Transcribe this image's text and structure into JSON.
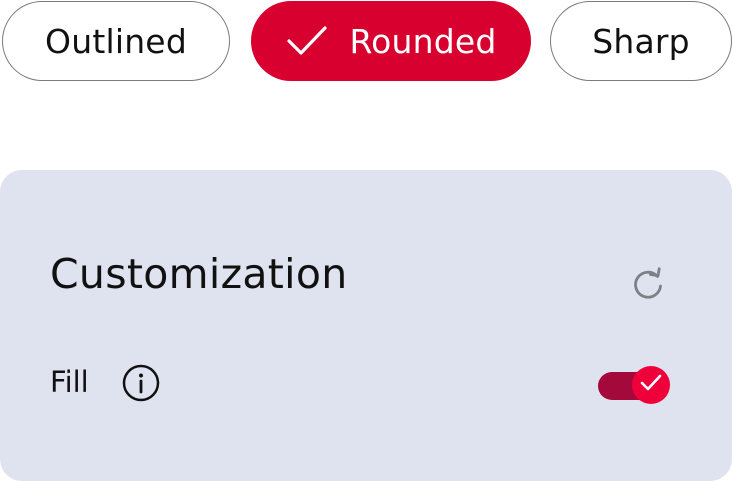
{
  "style_selector": {
    "options": [
      {
        "label": "Outlined",
        "selected": false
      },
      {
        "label": "Rounded",
        "selected": true
      },
      {
        "label": "Sharp",
        "selected": false
      }
    ],
    "selected_icon": "check-icon"
  },
  "customization": {
    "title": "Customization",
    "reset_icon": "refresh-icon",
    "fill": {
      "label": "Fill",
      "info_icon": "info-icon",
      "enabled": true,
      "toggle_icon": "check-icon"
    }
  },
  "colors": {
    "accent": "#d7002f",
    "toggle_thumb": "#f0003a",
    "toggle_track": "#a3093a",
    "panel_background": "#dfe2ef",
    "chip_border": "#7a7a7a"
  }
}
